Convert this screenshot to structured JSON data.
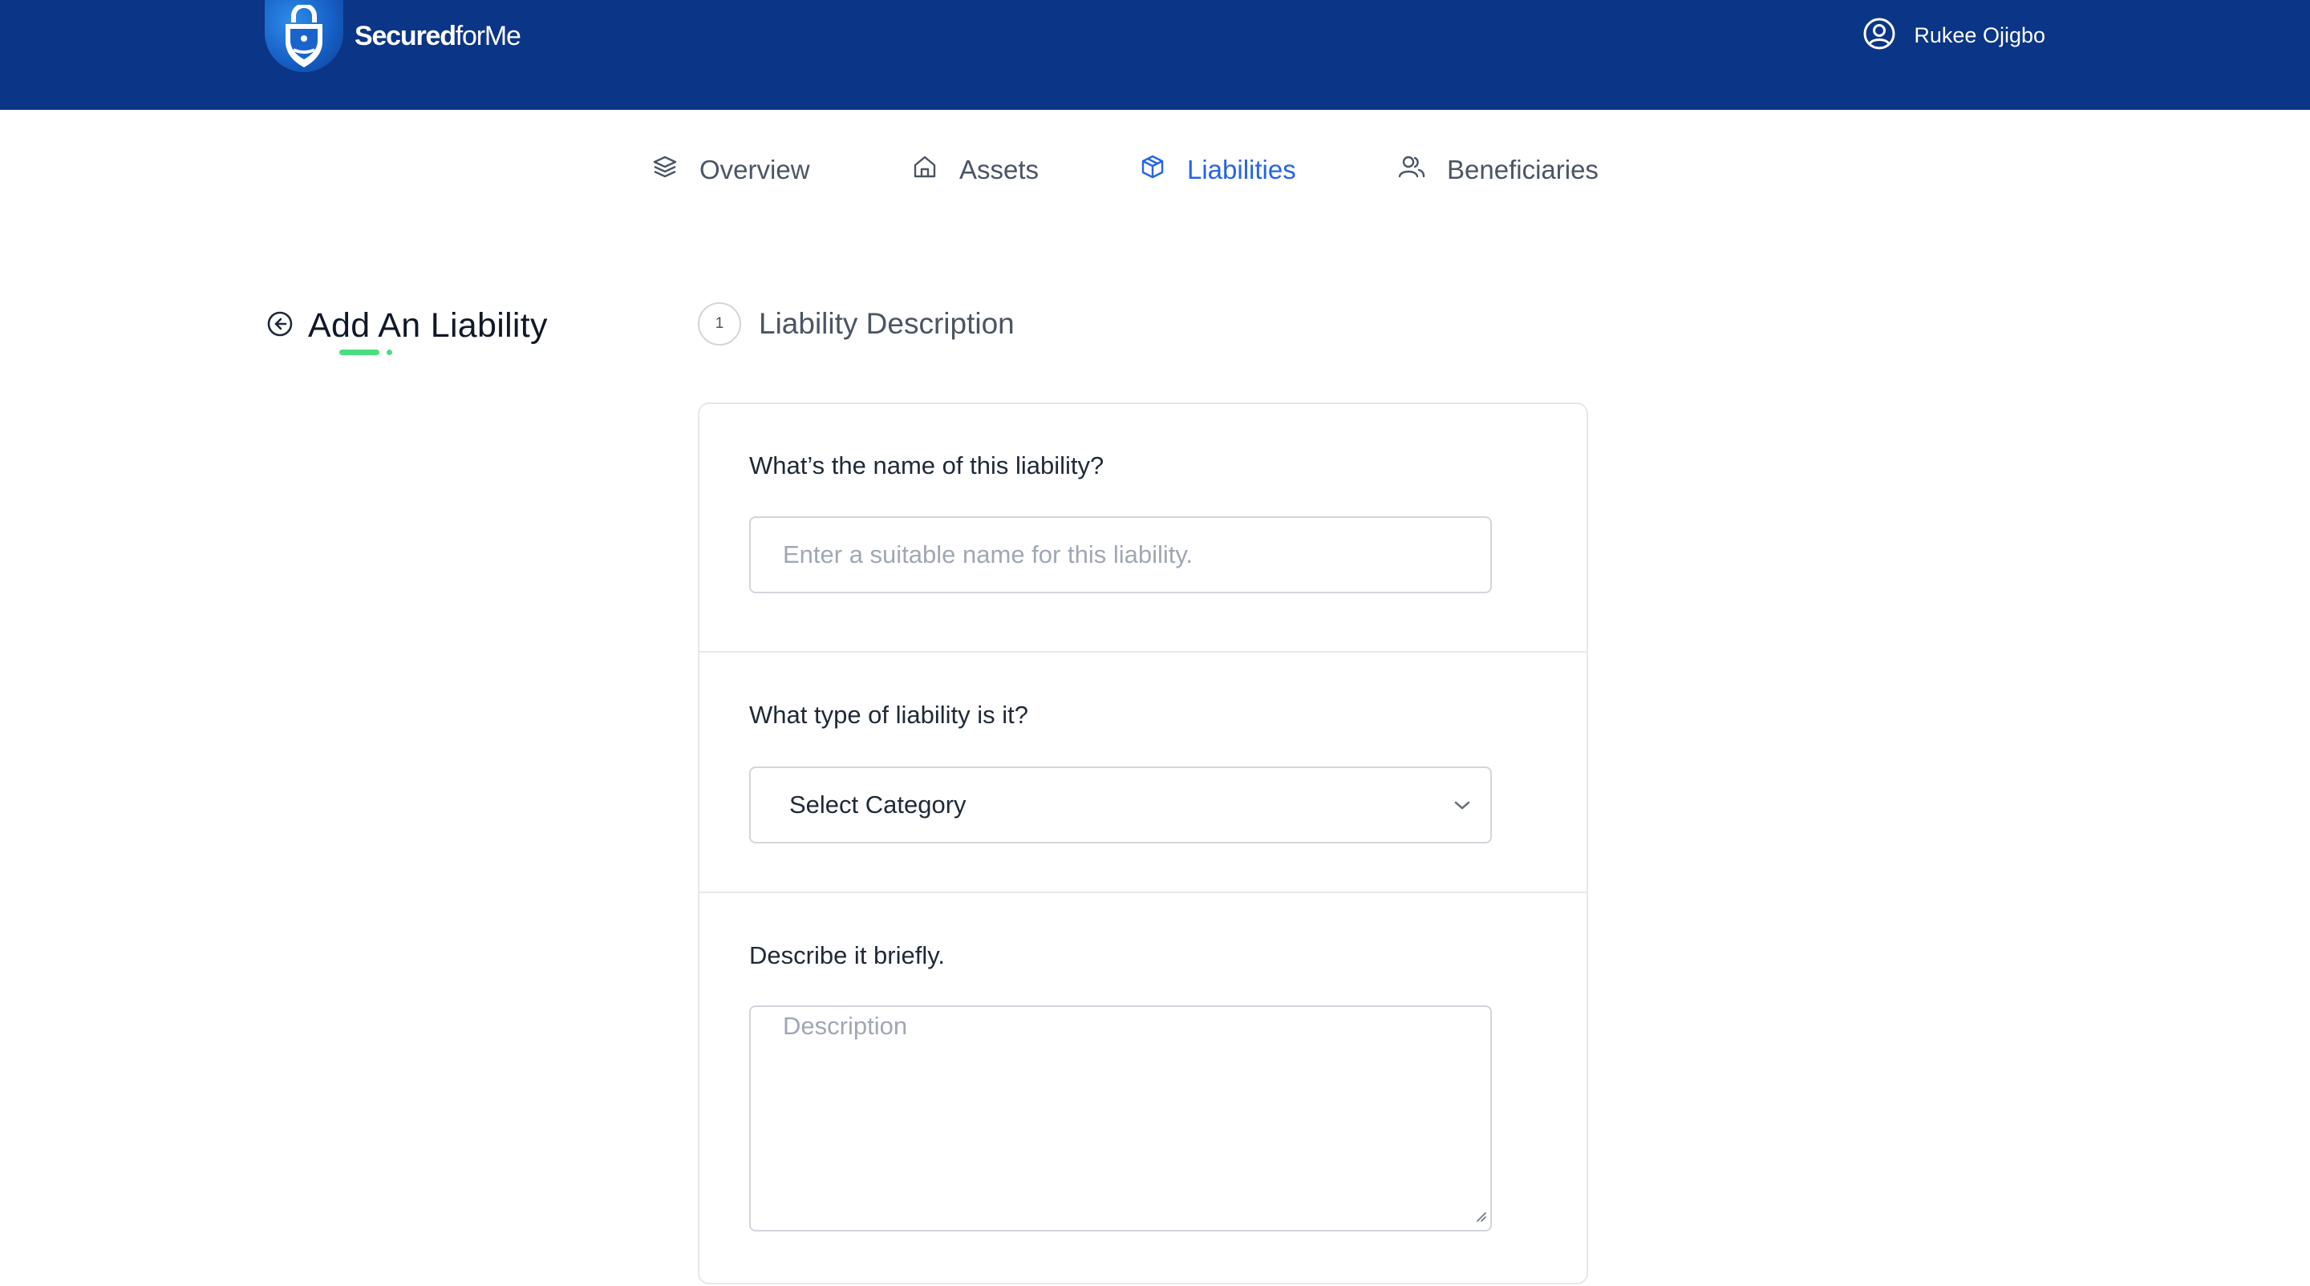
{
  "brand": {
    "name_bold": "Secured",
    "name_light": "forMe"
  },
  "header": {
    "user_name": "Rukee Ojigbo",
    "user_icon": "user-circle-icon"
  },
  "nav": {
    "items": [
      {
        "label": "Overview",
        "icon": "layers-icon",
        "active": false
      },
      {
        "label": "Assets",
        "icon": "home-icon",
        "active": false
      },
      {
        "label": "Liabilities",
        "icon": "box-icon",
        "active": true
      },
      {
        "label": "Beneficiaries",
        "icon": "users-icon",
        "active": false
      }
    ]
  },
  "page": {
    "title": "Add An Liability",
    "back_icon": "arrow-left-circle-icon"
  },
  "step": {
    "number": "1",
    "title": "Liability Description"
  },
  "form": {
    "name": {
      "label": "What’s the name of this liability?",
      "placeholder": "Enter a suitable name for this liability.",
      "value": ""
    },
    "type": {
      "label": "What type of liability is it?",
      "selected": "Select Category"
    },
    "description": {
      "label": "Describe it briefly.",
      "placeholder": "Description",
      "value": ""
    }
  },
  "colors": {
    "header_bg": "#0b3587",
    "active_nav": "#2563eb",
    "accent_green": "#4ade80"
  }
}
